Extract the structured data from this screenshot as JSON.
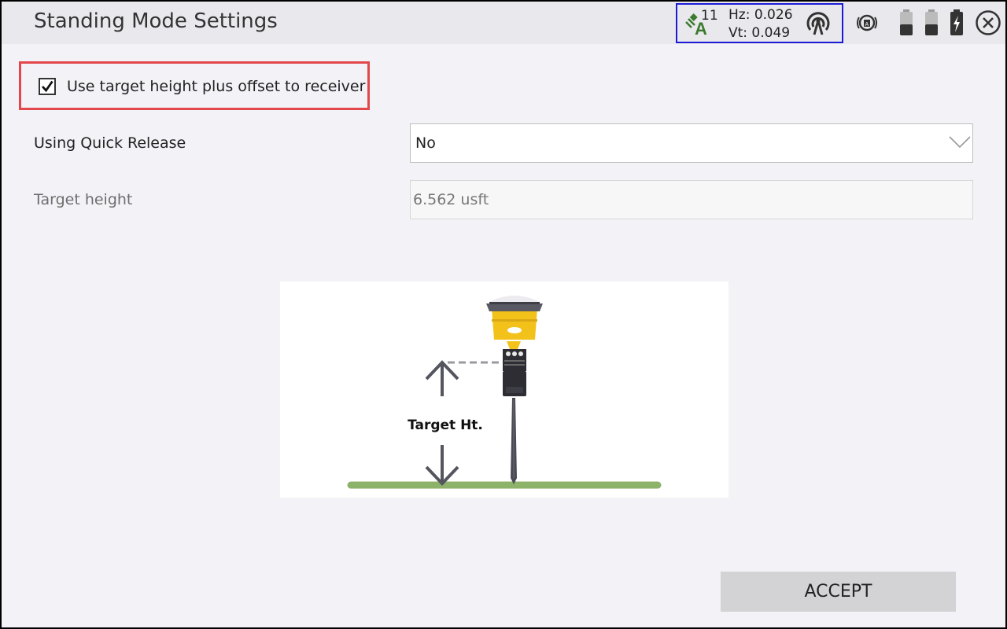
{
  "window": {
    "title": "Standing Mode Settings"
  },
  "status": {
    "satellites": "11",
    "hz": "Hz: 0.026",
    "vt": "Vt: 0.049"
  },
  "icons": [
    "satellite-icon",
    "radio-signal-icon",
    "gnss-receiver-icon",
    "battery-low-icon",
    "battery-low-icon",
    "battery-charging-icon",
    "close-icon"
  ],
  "checkbox": {
    "label": "Use target height plus offset to receiver",
    "checked": true
  },
  "quick_release": {
    "label": "Using Quick Release",
    "value": "No"
  },
  "target_height": {
    "label": "Target height",
    "value": "6.562 usft"
  },
  "diagram": {
    "label": "Target Ht."
  },
  "buttons": {
    "accept": "ACCEPT"
  },
  "colors": {
    "highlight_border": "#e2474b",
    "status_border": "#1b1bd6",
    "receiver_yellow": "#f2c21a",
    "ground_green": "#8db26a"
  }
}
